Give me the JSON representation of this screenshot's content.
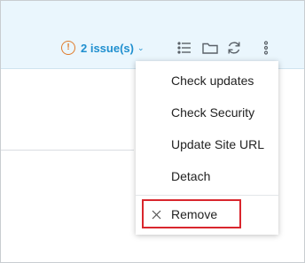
{
  "header": {
    "issues": {
      "icon": "exclamation-circle-icon",
      "label": "2 issue(s)",
      "caret": "chevron-down-icon",
      "color": "#1f8fcf",
      "icon_color": "#e07b2a"
    },
    "icons": [
      "list-icon",
      "folder-icon",
      "refresh-icon",
      "more-vertical-icon"
    ],
    "background": "#eaf6fd"
  },
  "menu": {
    "items": [
      {
        "label": "Check updates"
      },
      {
        "label": "Check Security"
      },
      {
        "label": "Update Site URL"
      },
      {
        "label": "Detach"
      }
    ],
    "remove": {
      "label": "Remove",
      "icon": "close-icon"
    },
    "highlight_color": "#d9262d"
  }
}
